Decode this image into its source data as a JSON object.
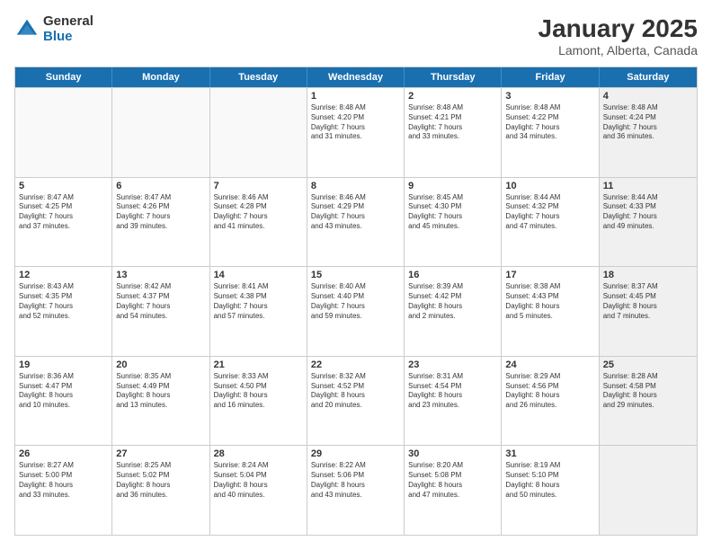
{
  "logo": {
    "general": "General",
    "blue": "Blue"
  },
  "title": "January 2025",
  "subtitle": "Lamont, Alberta, Canada",
  "header_days": [
    "Sunday",
    "Monday",
    "Tuesday",
    "Wednesday",
    "Thursday",
    "Friday",
    "Saturday"
  ],
  "weeks": [
    [
      {
        "day": "",
        "empty": true
      },
      {
        "day": "",
        "empty": true
      },
      {
        "day": "",
        "empty": true
      },
      {
        "day": "1",
        "lines": [
          "Sunrise: 8:48 AM",
          "Sunset: 4:20 PM",
          "Daylight: 7 hours",
          "and 31 minutes."
        ]
      },
      {
        "day": "2",
        "lines": [
          "Sunrise: 8:48 AM",
          "Sunset: 4:21 PM",
          "Daylight: 7 hours",
          "and 33 minutes."
        ]
      },
      {
        "day": "3",
        "lines": [
          "Sunrise: 8:48 AM",
          "Sunset: 4:22 PM",
          "Daylight: 7 hours",
          "and 34 minutes."
        ]
      },
      {
        "day": "4",
        "lines": [
          "Sunrise: 8:48 AM",
          "Sunset: 4:24 PM",
          "Daylight: 7 hours",
          "and 36 minutes."
        ],
        "shaded": true
      }
    ],
    [
      {
        "day": "5",
        "lines": [
          "Sunrise: 8:47 AM",
          "Sunset: 4:25 PM",
          "Daylight: 7 hours",
          "and 37 minutes."
        ]
      },
      {
        "day": "6",
        "lines": [
          "Sunrise: 8:47 AM",
          "Sunset: 4:26 PM",
          "Daylight: 7 hours",
          "and 39 minutes."
        ]
      },
      {
        "day": "7",
        "lines": [
          "Sunrise: 8:46 AM",
          "Sunset: 4:28 PM",
          "Daylight: 7 hours",
          "and 41 minutes."
        ]
      },
      {
        "day": "8",
        "lines": [
          "Sunrise: 8:46 AM",
          "Sunset: 4:29 PM",
          "Daylight: 7 hours",
          "and 43 minutes."
        ]
      },
      {
        "day": "9",
        "lines": [
          "Sunrise: 8:45 AM",
          "Sunset: 4:30 PM",
          "Daylight: 7 hours",
          "and 45 minutes."
        ]
      },
      {
        "day": "10",
        "lines": [
          "Sunrise: 8:44 AM",
          "Sunset: 4:32 PM",
          "Daylight: 7 hours",
          "and 47 minutes."
        ]
      },
      {
        "day": "11",
        "lines": [
          "Sunrise: 8:44 AM",
          "Sunset: 4:33 PM",
          "Daylight: 7 hours",
          "and 49 minutes."
        ],
        "shaded": true
      }
    ],
    [
      {
        "day": "12",
        "lines": [
          "Sunrise: 8:43 AM",
          "Sunset: 4:35 PM",
          "Daylight: 7 hours",
          "and 52 minutes."
        ]
      },
      {
        "day": "13",
        "lines": [
          "Sunrise: 8:42 AM",
          "Sunset: 4:37 PM",
          "Daylight: 7 hours",
          "and 54 minutes."
        ]
      },
      {
        "day": "14",
        "lines": [
          "Sunrise: 8:41 AM",
          "Sunset: 4:38 PM",
          "Daylight: 7 hours",
          "and 57 minutes."
        ]
      },
      {
        "day": "15",
        "lines": [
          "Sunrise: 8:40 AM",
          "Sunset: 4:40 PM",
          "Daylight: 7 hours",
          "and 59 minutes."
        ]
      },
      {
        "day": "16",
        "lines": [
          "Sunrise: 8:39 AM",
          "Sunset: 4:42 PM",
          "Daylight: 8 hours",
          "and 2 minutes."
        ]
      },
      {
        "day": "17",
        "lines": [
          "Sunrise: 8:38 AM",
          "Sunset: 4:43 PM",
          "Daylight: 8 hours",
          "and 5 minutes."
        ]
      },
      {
        "day": "18",
        "lines": [
          "Sunrise: 8:37 AM",
          "Sunset: 4:45 PM",
          "Daylight: 8 hours",
          "and 7 minutes."
        ],
        "shaded": true
      }
    ],
    [
      {
        "day": "19",
        "lines": [
          "Sunrise: 8:36 AM",
          "Sunset: 4:47 PM",
          "Daylight: 8 hours",
          "and 10 minutes."
        ]
      },
      {
        "day": "20",
        "lines": [
          "Sunrise: 8:35 AM",
          "Sunset: 4:49 PM",
          "Daylight: 8 hours",
          "and 13 minutes."
        ]
      },
      {
        "day": "21",
        "lines": [
          "Sunrise: 8:33 AM",
          "Sunset: 4:50 PM",
          "Daylight: 8 hours",
          "and 16 minutes."
        ]
      },
      {
        "day": "22",
        "lines": [
          "Sunrise: 8:32 AM",
          "Sunset: 4:52 PM",
          "Daylight: 8 hours",
          "and 20 minutes."
        ]
      },
      {
        "day": "23",
        "lines": [
          "Sunrise: 8:31 AM",
          "Sunset: 4:54 PM",
          "Daylight: 8 hours",
          "and 23 minutes."
        ]
      },
      {
        "day": "24",
        "lines": [
          "Sunrise: 8:29 AM",
          "Sunset: 4:56 PM",
          "Daylight: 8 hours",
          "and 26 minutes."
        ]
      },
      {
        "day": "25",
        "lines": [
          "Sunrise: 8:28 AM",
          "Sunset: 4:58 PM",
          "Daylight: 8 hours",
          "and 29 minutes."
        ],
        "shaded": true
      }
    ],
    [
      {
        "day": "26",
        "lines": [
          "Sunrise: 8:27 AM",
          "Sunset: 5:00 PM",
          "Daylight: 8 hours",
          "and 33 minutes."
        ]
      },
      {
        "day": "27",
        "lines": [
          "Sunrise: 8:25 AM",
          "Sunset: 5:02 PM",
          "Daylight: 8 hours",
          "and 36 minutes."
        ]
      },
      {
        "day": "28",
        "lines": [
          "Sunrise: 8:24 AM",
          "Sunset: 5:04 PM",
          "Daylight: 8 hours",
          "and 40 minutes."
        ]
      },
      {
        "day": "29",
        "lines": [
          "Sunrise: 8:22 AM",
          "Sunset: 5:06 PM",
          "Daylight: 8 hours",
          "and 43 minutes."
        ]
      },
      {
        "day": "30",
        "lines": [
          "Sunrise: 8:20 AM",
          "Sunset: 5:08 PM",
          "Daylight: 8 hours",
          "and 47 minutes."
        ]
      },
      {
        "day": "31",
        "lines": [
          "Sunrise: 8:19 AM",
          "Sunset: 5:10 PM",
          "Daylight: 8 hours",
          "and 50 minutes."
        ]
      },
      {
        "day": "",
        "empty": true,
        "shaded": true
      }
    ]
  ]
}
